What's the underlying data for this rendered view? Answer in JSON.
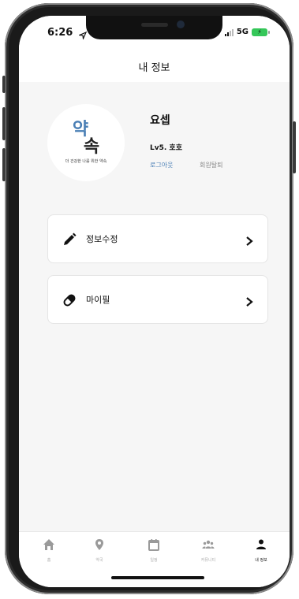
{
  "status": {
    "time": "6:26",
    "network": "5G",
    "battery_icon": "battery-charging-icon"
  },
  "header": {
    "title": "내 정보"
  },
  "profile": {
    "logo_top": "약",
    "logo_bottom": "속",
    "logo_tagline": "더 건강한 나를 위한 약속",
    "name": "요셉",
    "level": "Lv5. 호호",
    "logout_label": "로그아웃",
    "withdraw_label": "회원탈퇴"
  },
  "menu": {
    "items": [
      {
        "label": "정보수정",
        "icon": "pencil-icon"
      },
      {
        "label": "마이필",
        "icon": "pill-icon"
      }
    ]
  },
  "tabbar": {
    "items": [
      {
        "label": "홈",
        "icon": "home-icon"
      },
      {
        "label": "약국",
        "icon": "map-pin-icon"
      },
      {
        "label": "일정",
        "icon": "calendar-icon"
      },
      {
        "label": "커뮤니티",
        "icon": "community-icon"
      },
      {
        "label": "내 정보",
        "icon": "user-icon",
        "active": true
      }
    ]
  },
  "colors": {
    "accent": "#4a7fb5",
    "muted": "#888888",
    "battery": "#35c759"
  }
}
